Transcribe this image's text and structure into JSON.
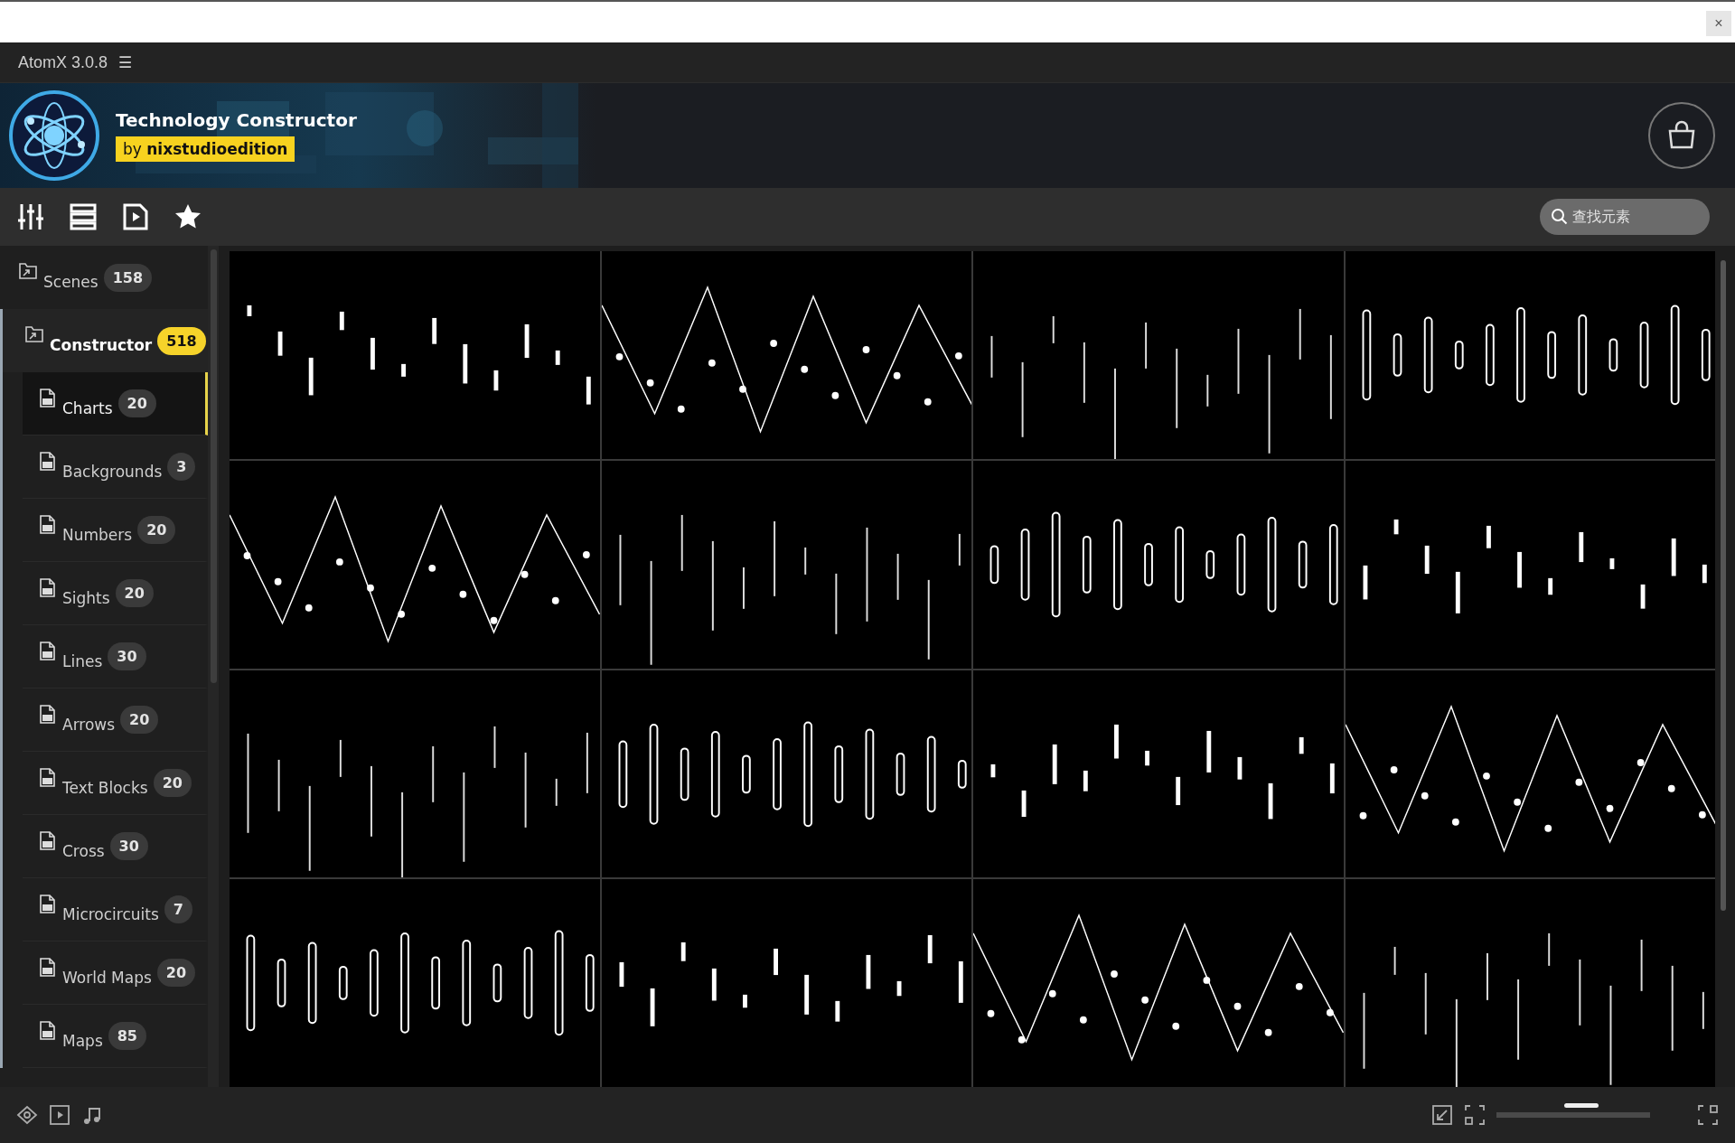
{
  "window": {
    "close": "×"
  },
  "app": {
    "title": "AtomX 3.0.8",
    "menu": "☰"
  },
  "banner": {
    "title": "Technology Constructor",
    "author": "by **nixstudioedition**"
  },
  "search": {
    "placeholder": "查找元素"
  },
  "sidebar": {
    "categories": [
      {
        "label": "Scenes",
        "count": "158",
        "expanded": false
      },
      {
        "label": "Constructor",
        "count": "518",
        "expanded": true,
        "children": [
          {
            "label": "Charts",
            "count": "20",
            "selected": true
          },
          {
            "label": "Backgrounds",
            "count": "3",
            "selected": false
          },
          {
            "label": "Numbers",
            "count": "20",
            "selected": false
          },
          {
            "label": "Sights",
            "count": "20",
            "selected": false
          },
          {
            "label": "Lines",
            "count": "30",
            "selected": false
          },
          {
            "label": "Arrows",
            "count": "20",
            "selected": false
          },
          {
            "label": "Text Blocks",
            "count": "20",
            "selected": false
          },
          {
            "label": "Cross",
            "count": "30",
            "selected": false
          },
          {
            "label": "Microcircuits",
            "count": "7",
            "selected": false
          },
          {
            "label": "World Maps",
            "count": "20",
            "selected": false
          },
          {
            "label": "Maps",
            "count": "85",
            "selected": false
          }
        ]
      }
    ]
  },
  "zoom": {
    "level": 0.55
  }
}
